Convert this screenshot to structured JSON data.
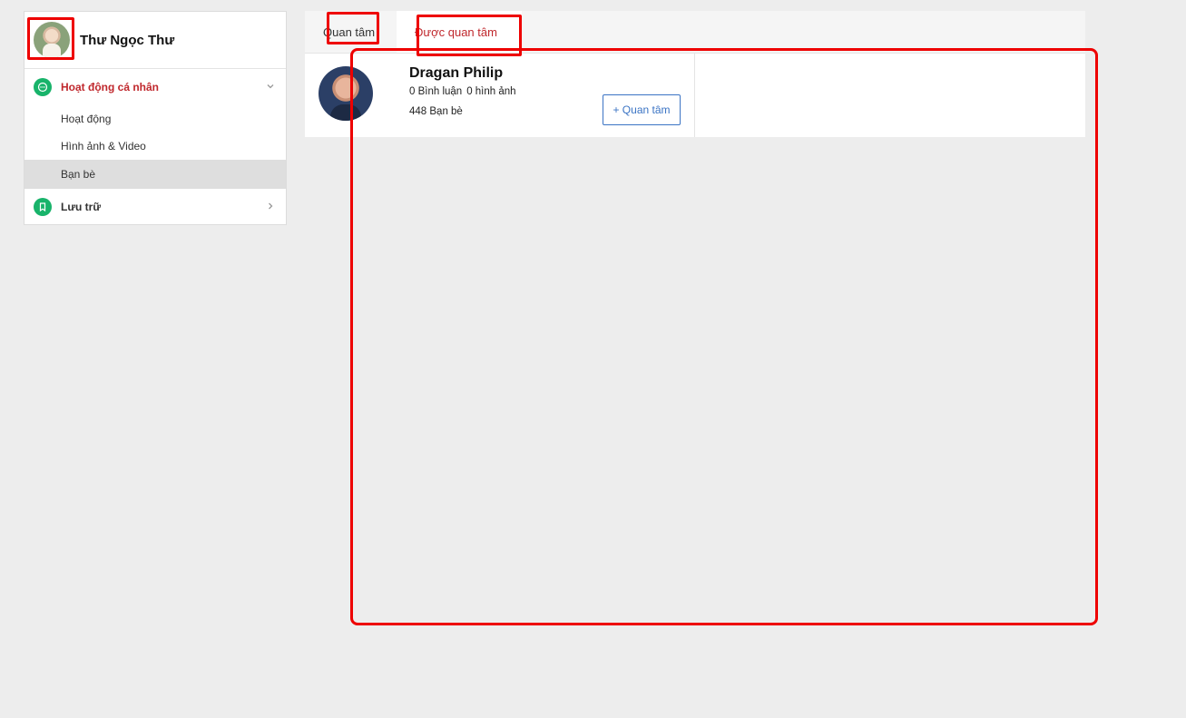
{
  "profile": {
    "name": "Thư Ngọc Thư",
    "avatar_icon": "user-avatar"
  },
  "sidebar": {
    "groups": [
      {
        "label": "Hoạt động cá nhân",
        "icon": "chat-bubble-icon",
        "expanded": true,
        "items": [
          {
            "label": "Hoạt động"
          },
          {
            "label": "Hình ảnh & Video"
          },
          {
            "label": "Bạn bè",
            "selected": true
          }
        ]
      },
      {
        "label": "Lưu trữ",
        "icon": "bookmark-icon",
        "expanded": false
      }
    ]
  },
  "tabs": [
    {
      "label": "Quan tâm"
    },
    {
      "label": "Được quan tâm",
      "active": true
    }
  ],
  "cards": [
    {
      "name": "Dragan Philip",
      "comments": "0 Bình luận",
      "images": "0 hình ảnh",
      "friends": "448 Bạn bè",
      "follow_label": "+ Quan tâm"
    }
  ],
  "colors": {
    "accent_red": "#c0282d",
    "icon_green": "#18b36a",
    "button_blue": "#3b74c4",
    "annotation_red": "#ee0000"
  }
}
